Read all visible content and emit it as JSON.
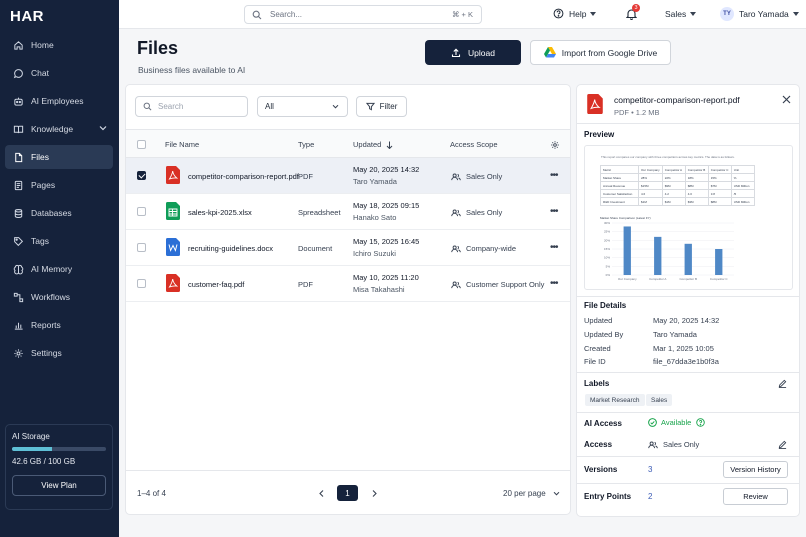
{
  "app": {
    "logo": "HAR"
  },
  "colors": {
    "sidebar_bg": "#15223b",
    "accent": "#15223b",
    "storage_fill": "#5fc0d6",
    "success": "#16a34a",
    "badge": "#e53935",
    "link": "#3b5bb5"
  },
  "sidebar": {
    "items": [
      {
        "label": "Home",
        "icon": "home-icon"
      },
      {
        "label": "Chat",
        "icon": "chat-icon"
      },
      {
        "label": "AI Employees",
        "icon": "robot-icon"
      },
      {
        "label": "Knowledge",
        "icon": "book-icon"
      },
      {
        "label": "Files",
        "icon": "file-icon"
      },
      {
        "label": "Pages",
        "icon": "pages-icon"
      },
      {
        "label": "Databases",
        "icon": "database-icon"
      },
      {
        "label": "Tags",
        "icon": "tag-icon"
      },
      {
        "label": "AI Memory",
        "icon": "brain-icon"
      },
      {
        "label": "Workflows",
        "icon": "workflow-icon"
      },
      {
        "label": "Reports",
        "icon": "chart-icon"
      },
      {
        "label": "Settings",
        "icon": "gear-icon"
      }
    ],
    "storage": {
      "label": "AI Storage",
      "usage": "42.6 GB / 100 GB",
      "fraction": 0.426,
      "button": "View Plan"
    }
  },
  "topbar": {
    "search_placeholder": "Search...",
    "shortcut": "⌘ + K",
    "help": "Help",
    "notification_count": "3",
    "workspace": "Sales",
    "user_initials": "TY",
    "user_name": "Taro Yamada"
  },
  "header": {
    "title": "Files",
    "subtitle": "Business files available to AI",
    "upload_label": "Upload",
    "import_label": "Import from Google Drive"
  },
  "filters": {
    "search_placeholder": "Search",
    "select_value": "All",
    "filter_label": "Filter"
  },
  "table": {
    "columns": {
      "name": "File Name",
      "type": "Type",
      "updated": "Updated",
      "scope": "Access Scope"
    },
    "rows": [
      {
        "name": "competitor-comparison-report.pdf",
        "type": "PDF",
        "date": "May 20, 2025 14:32",
        "by": "Taro Yamada",
        "scope": "Sales Only",
        "icon": "pdf-icon",
        "selected": true
      },
      {
        "name": "sales-kpi-2025.xlsx",
        "type": "Spreadsheet",
        "date": "May 18, 2025 09:15",
        "by": "Hanako Sato",
        "scope": "Sales Only",
        "icon": "sheet-icon",
        "selected": false
      },
      {
        "name": "recruiting-guidelines.docx",
        "type": "Document",
        "date": "May 15, 2025 16:45",
        "by": "Ichiro Suzuki",
        "scope": "Company-wide",
        "icon": "doc-icon",
        "selected": false
      },
      {
        "name": "customer-faq.pdf",
        "type": "PDF",
        "date": "May 10, 2025 11:20",
        "by": "Misa Takahashi",
        "scope": "Customer Support Only",
        "icon": "pdf-icon",
        "selected": false
      }
    ],
    "footer": {
      "range": "1–4 of 4",
      "page": "1",
      "per_page": "20 per page"
    }
  },
  "detail": {
    "name": "competitor-comparison-report.pdf",
    "meta": "PDF  •  1.2 MB",
    "preview_label": "Preview",
    "preview": {
      "note": "This report compares our company with three competitors across key metrics. The data is as follows.",
      "table": [
        [
          "Metric",
          "Our Company",
          "Competitor A",
          "Competitor B",
          "Competitor C",
          "Unit"
        ],
        [
          "Market Share",
          "28%",
          "22%",
          "18%",
          "15%",
          "%"
        ],
        [
          "Annual Revenue",
          "$15M",
          "$9M",
          "$8M",
          "$7M",
          "USD Million"
        ],
        [
          "Customer Satisfaction",
          "4.6",
          "4.2",
          "4.0",
          "3.8",
          "/5"
        ],
        [
          "R&D Investment",
          "$1M",
          "$1M",
          "$3M",
          "$8M",
          "USD Million"
        ]
      ],
      "chart_title": "Market Share Comparison (Latest FY)",
      "chart_categories": [
        "Our Company",
        "Competitor A",
        "Competitor B",
        "Competitor C"
      ],
      "chart_values": [
        28,
        22,
        18,
        15
      ],
      "chart_ticks": [
        "30%",
        "25%",
        "20%",
        "15%",
        "10%",
        "5%",
        "0%"
      ]
    },
    "details_label": "File Details",
    "fields": [
      {
        "key": "Updated",
        "value": "May 20, 2025 14:32"
      },
      {
        "key": "Updated By",
        "value": "Taro Yamada"
      },
      {
        "key": "Created",
        "value": "Mar 1, 2025 10:05"
      },
      {
        "key": "File ID",
        "value": "file_67dda3e1b0f3a"
      }
    ],
    "labels_label": "Labels",
    "labels": [
      "Market Research",
      "Sales"
    ],
    "ai_access_label": "AI Access",
    "ai_access_value": "Available",
    "access_label": "Access",
    "access_value": "Sales Only",
    "versions_label": "Versions",
    "versions_count": "3",
    "versions_button": "Version History",
    "entry_label": "Entry Points",
    "entry_count": "2",
    "entry_button": "Review"
  }
}
